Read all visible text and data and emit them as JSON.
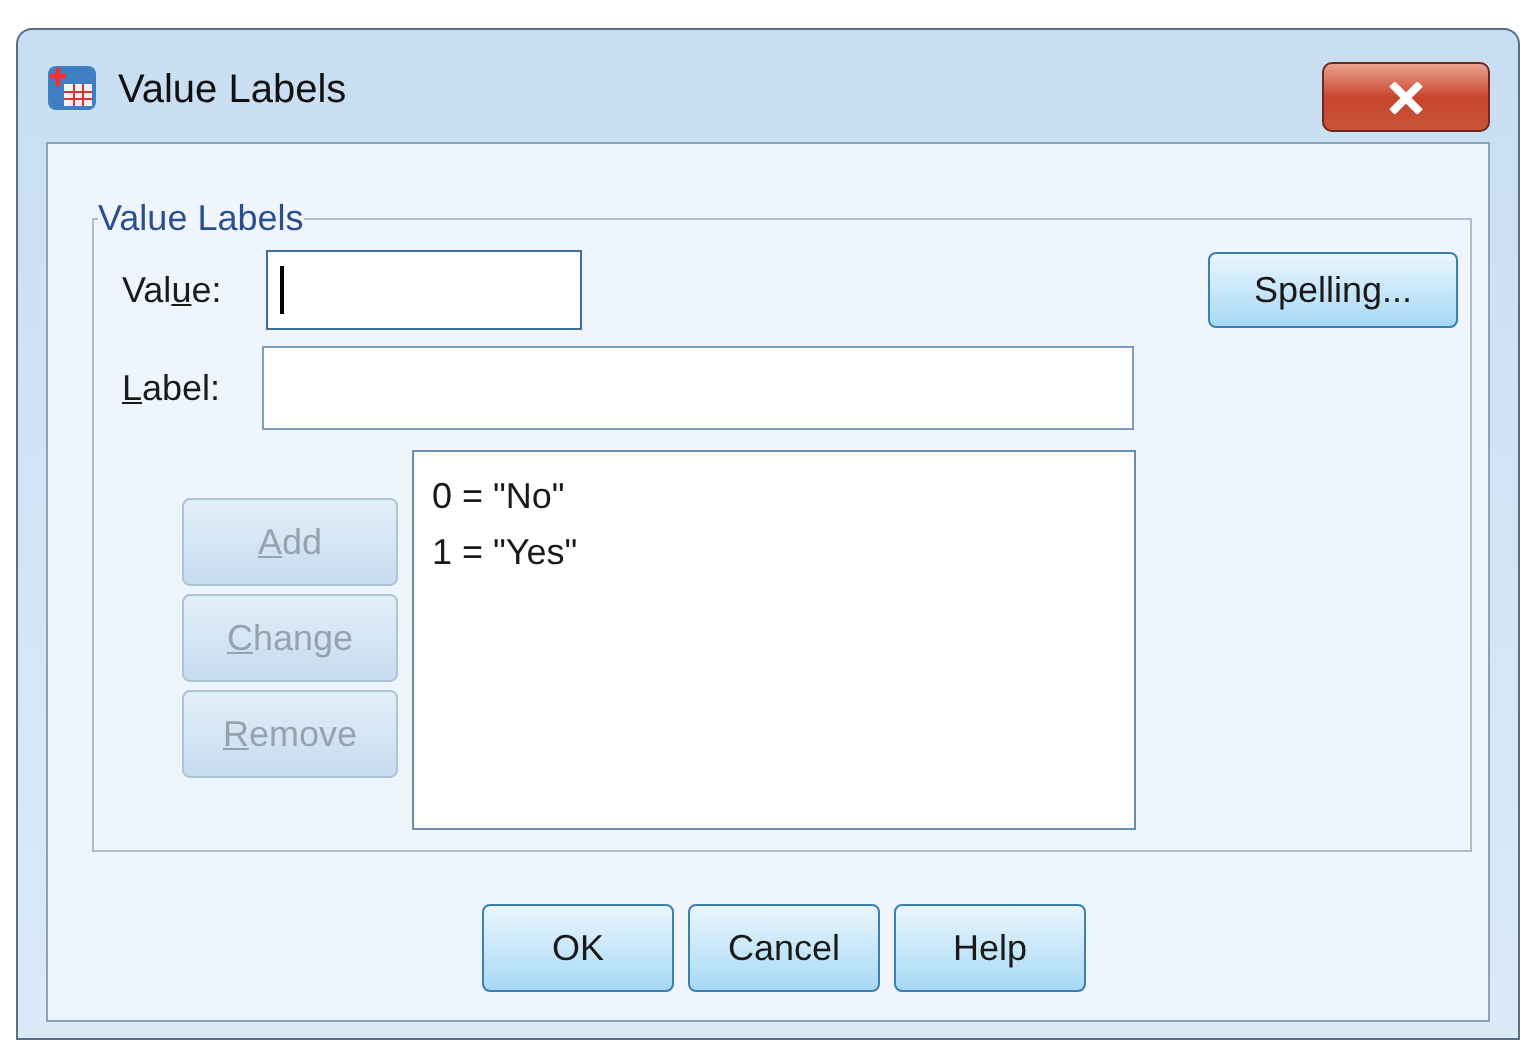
{
  "window": {
    "title": "Value Labels"
  },
  "group": {
    "legend": "Value Labels"
  },
  "value_field": {
    "label": {
      "before": "Val",
      "key": "u",
      "after": "e:"
    },
    "focused": true
  },
  "label_field": {
    "label": {
      "key": "L",
      "after": "abel:"
    }
  },
  "spelling_button": {
    "label": "Spelling..."
  },
  "side_buttons": [
    {
      "label": {
        "key": "A",
        "after": "dd"
      },
      "disabled": true
    },
    {
      "label": {
        "key": "C",
        "after": "hange"
      },
      "disabled": true
    },
    {
      "label": {
        "key": "R",
        "after": "emove"
      },
      "disabled": true
    }
  ],
  "labels_list": [
    {
      "text": "0 = \"No\"",
      "selected": false
    },
    {
      "text": "1 = \"Yes\"",
      "selected": false
    }
  ],
  "buttons": [
    "OK",
    "Cancel",
    "Help"
  ]
}
